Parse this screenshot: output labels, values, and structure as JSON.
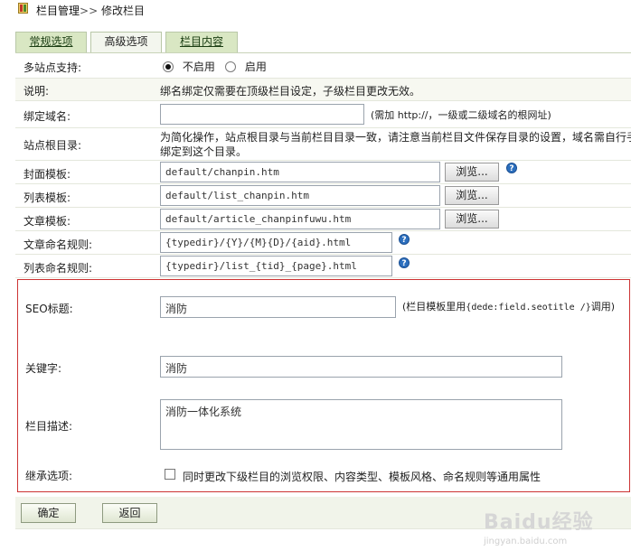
{
  "breadcrumb": {
    "section": "栏目管理",
    "separator": ">>",
    "current": "修改栏目"
  },
  "tabs": [
    {
      "label": "常规选项",
      "active": false
    },
    {
      "label": "高级选项",
      "active": true
    },
    {
      "label": "栏目内容",
      "active": false
    }
  ],
  "multisite": {
    "label": "多站点支持:",
    "options": [
      "不启用",
      "启用"
    ],
    "selected": "不启用"
  },
  "note": {
    "label": "说明:",
    "text": "绑名绑定仅需要在顶级栏目设定，子级栏目更改无效。"
  },
  "domain": {
    "label": "绑定域名:",
    "value": "",
    "hint": "(需加 http://，一级或二级域名的根网址)"
  },
  "site_root": {
    "label": "站点根目录:",
    "text_line1": "为简化操作，站点根目录与当前栏目目录一致，请注意当前栏目文件保存目录的设置，域名需自行手",
    "text_line2": "绑定到这个目录。"
  },
  "templates": {
    "browse_label": "浏览...",
    "cover_label": "封面模板:",
    "cover_value": "default/chanpin.htm",
    "list_label": "列表模板:",
    "list_value": "default/list_chanpin.htm",
    "article_label": "文章模板:",
    "article_value": "default/article_chanpinfuwu.htm"
  },
  "naming": {
    "article_label": "文章命名规则:",
    "article_value": "{typedir}/{Y}/{M}{D}/{aid}.html",
    "list_label": "列表命名规则:",
    "list_value": "{typedir}/list_{tid}_{page}.html"
  },
  "seo": {
    "title_label": "SEO标题:",
    "title_value": "消防",
    "title_hint_prefix": "(栏目模板里用",
    "title_hint_code": "{dede:field.seotitle /}",
    "title_hint_suffix": "调用)",
    "keywords_label": "关键字:",
    "keywords_value": "消防",
    "description_label": "栏目描述:",
    "description_value": "消防一体化系统",
    "inherit_label": "继承选项:",
    "inherit_text": "同时更改下级栏目的浏览权限、内容类型、模板风格、命名规则等通用属性",
    "inherit_checked": false
  },
  "actions": {
    "confirm_label": "确定",
    "back_label": "返回"
  },
  "watermark": {
    "brand": "Baidu经验",
    "url": "jingyan.baidu.com"
  },
  "colors": {
    "tab_bg": "#d9e7c3",
    "tab_active_bg": "#f3f6ee",
    "seo_border": "#cc3333",
    "help_icon": "#2c6fbe"
  }
}
